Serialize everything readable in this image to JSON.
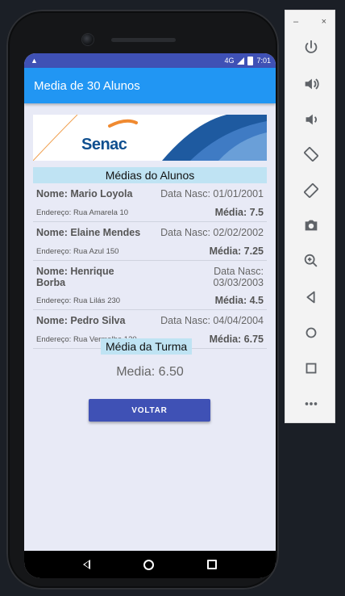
{
  "status_bar": {
    "time": "7:01",
    "network": "4G"
  },
  "app": {
    "title": "Media de 30 Alunos"
  },
  "banner": {
    "logo_text": "Senac"
  },
  "section_title": "Médias do Alunos",
  "students": [
    {
      "name": "Nome: Mario Loyola",
      "birth": "Data Nasc: 01/01/2001",
      "address": "Endereço: Rua Amarela 10",
      "average": "Média: 7.5"
    },
    {
      "name": "Nome: Elaine Mendes",
      "birth": "Data Nasc: 02/02/2002",
      "address": "Endereço: Rua Azul 150",
      "average": "Média: 7.25"
    },
    {
      "name": "Nome: Henrique Borba",
      "birth": "Data Nasc: 03/03/2003",
      "address": "Endereço: Rua Lilás 230",
      "average": "Média: 4.5"
    },
    {
      "name": "Nome: Pedro Silva",
      "birth": "Data Nasc: 04/04/2004",
      "address": "Endereço: Rua Vermelha 120",
      "average": "Média: 6.75"
    }
  ],
  "class_section": {
    "title": "Média da Turma",
    "value": "Media: 6.50"
  },
  "button": {
    "label": "VOLTAR"
  },
  "emulator_panel": {
    "minimize": "–",
    "close": "×",
    "tools": [
      "power-icon",
      "volume-up-icon",
      "volume-down-icon",
      "rotate-left-icon",
      "rotate-right-icon",
      "camera-icon",
      "zoom-icon",
      "back-icon",
      "home-icon",
      "overview-icon",
      "more-icon"
    ]
  },
  "colors": {
    "app_bar": "#2196f3",
    "status_bar": "#3f51b5",
    "button": "#3f51b5",
    "highlight": "#bfe3f3",
    "screen_bg": "#e8eaf6"
  }
}
